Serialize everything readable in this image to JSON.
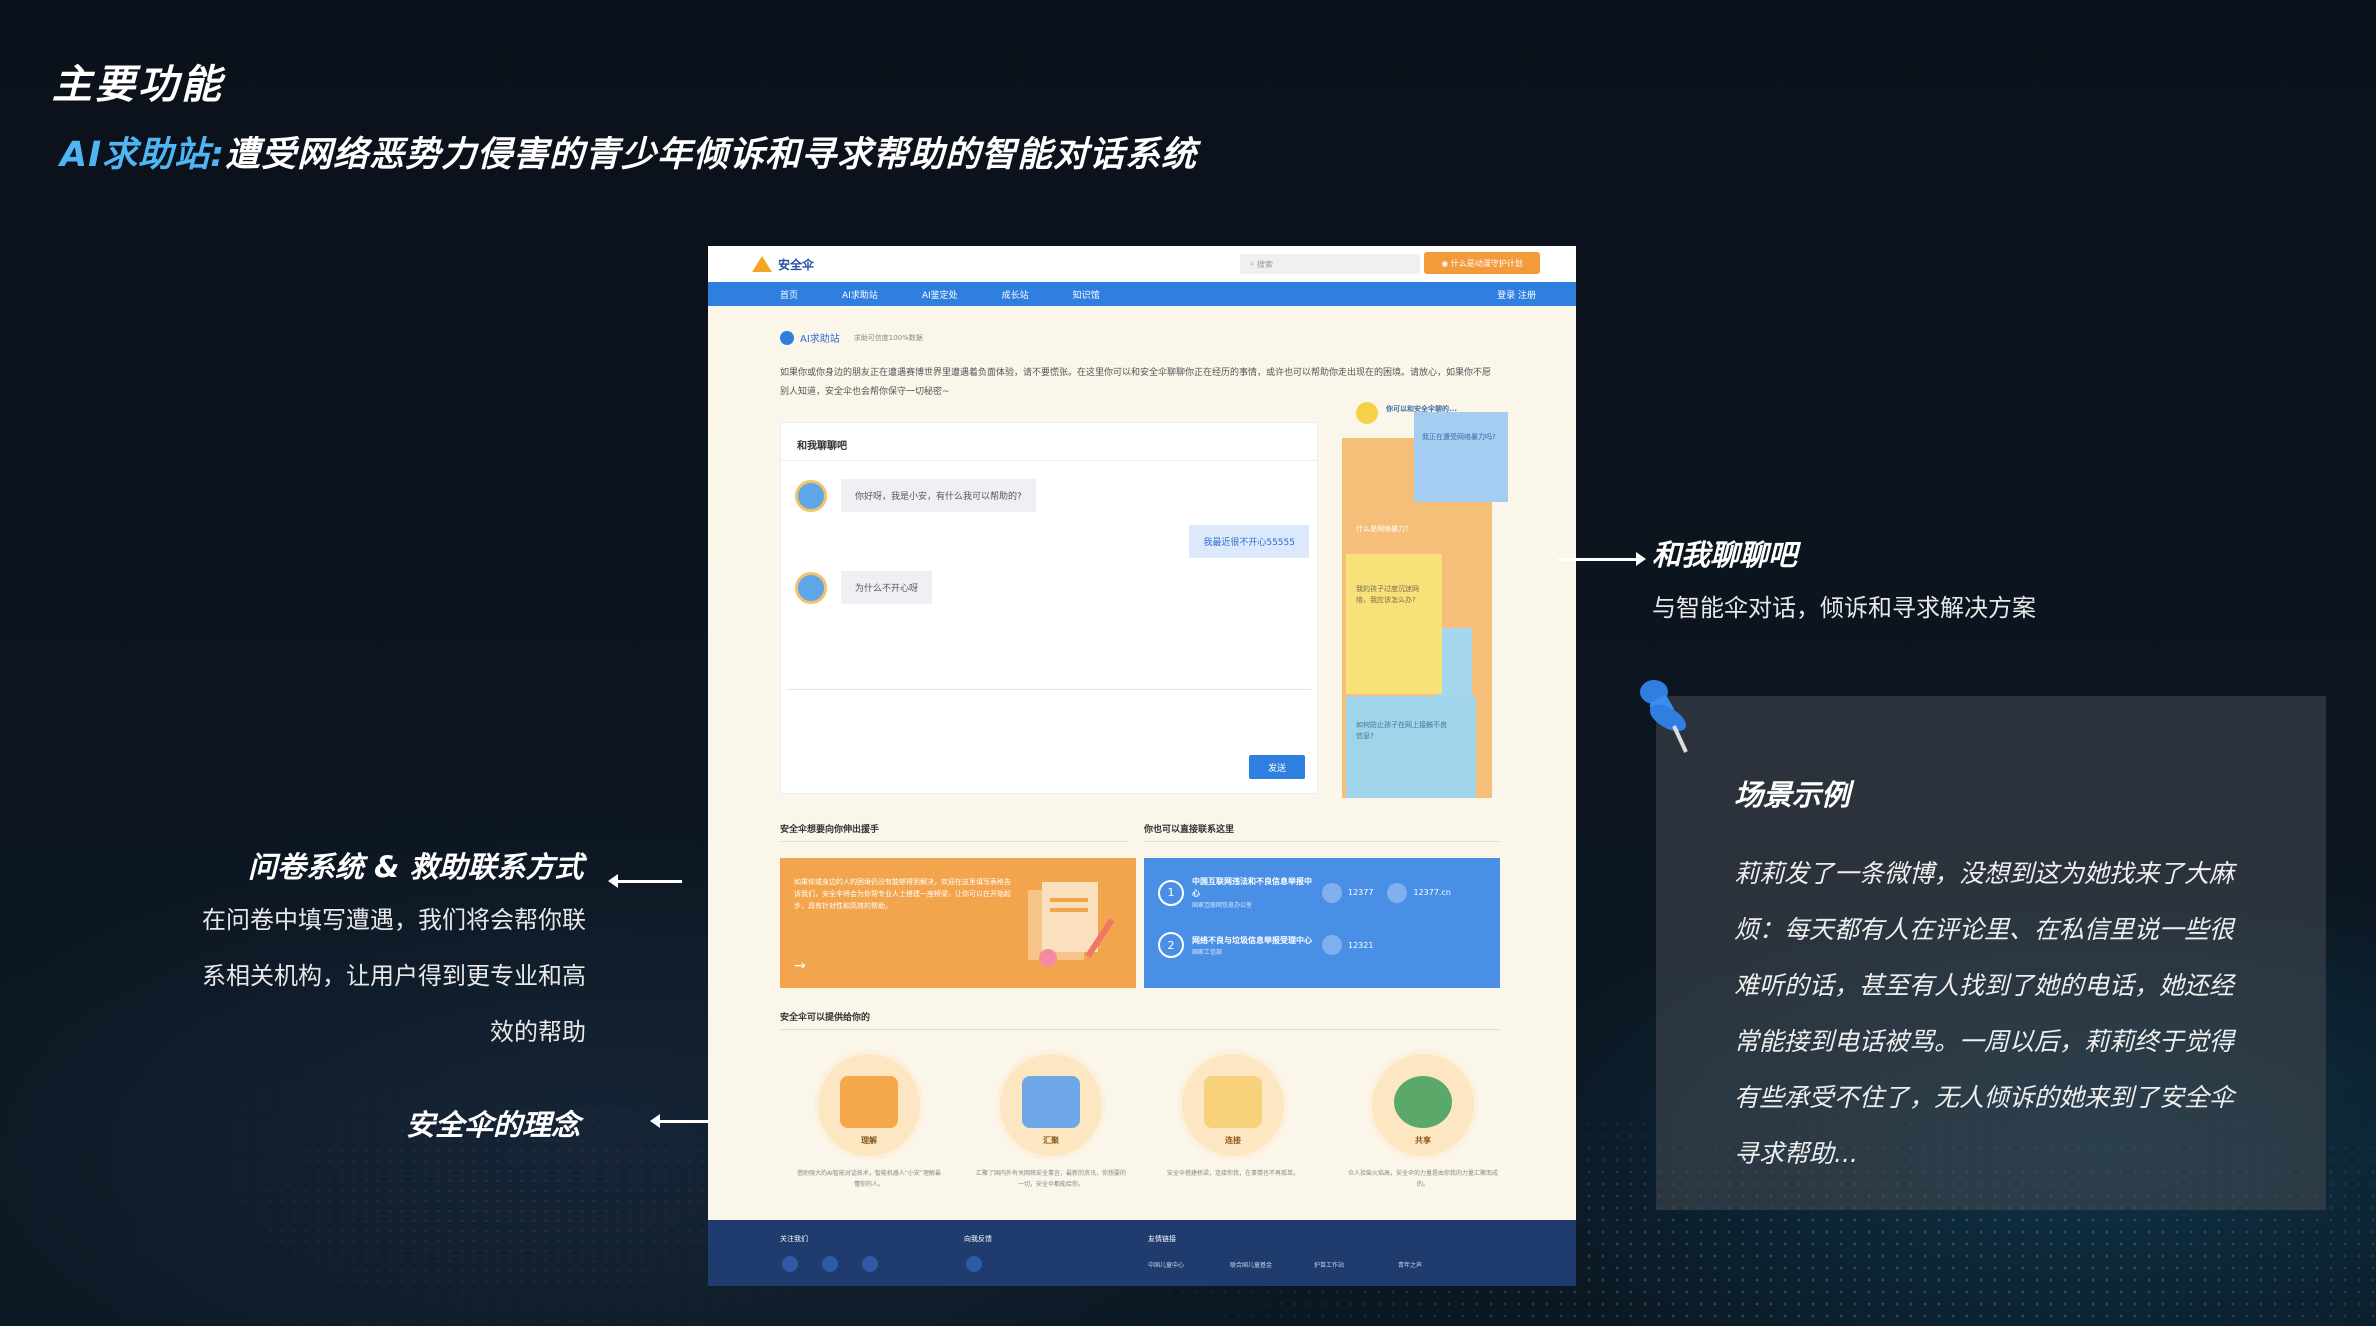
{
  "slide": {
    "title": "主要功能",
    "subtitle_accent": "AI求助站:",
    "subtitle_rest": "遭受网络恶势力侵害的青少年倾诉和寻求帮助的智能对话系统"
  },
  "site": {
    "logo": "安全伞",
    "search_placeholder": "搜索",
    "cta": "什么是动漫守护计划",
    "nav": [
      "首页",
      "AI求助站",
      "AI鉴定处",
      "成长站",
      "知识馆"
    ],
    "nav_active": "AI求助站",
    "auth": "登录   注册",
    "breadcrumb": "AI求助站",
    "breadcrumb_tip": "求助可信度100%数据",
    "intro": "如果你或你身边的朋友正在遭遇赛博世界里遭遇着负面体验，请不要慌张。在这里你可以和安全伞聊聊你正在经历的事情，或许也可以帮助你走出现在的困境。请放心，如果你不愿别人知道，安全伞也会帮你保守一切秘密~",
    "chat": {
      "title": "和我聊聊吧",
      "messages": [
        {
          "from": "bot",
          "text": "你好呀，我是小安，有什么我可以帮助的?"
        },
        {
          "from": "me",
          "text": "我最近很不开心55555"
        },
        {
          "from": "bot",
          "text": "为什么不开心呀"
        }
      ],
      "send": "发送"
    },
    "side_cards": {
      "heading": "你可以和安全伞聊的...",
      "q1": "我正在遭受网络暴力吗?",
      "q2": "什么是网络暴力?",
      "q3": "我的孩子过度沉迷网络，我应该怎么办?",
      "q4": "如何防止孩子在网上接触不良信息?"
    },
    "help_section": {
      "title": "安全伞想要向你伸出援手",
      "text": "如果你或身边的人的困境仍没有能够得到解决，欢迎在这里填写表格告诉我们，安全伞将会为你帮专业人士搭建一座桥梁，让你可以在开始起步，具有针对性和高效的帮助。"
    },
    "contact_section": {
      "title": "你也可以直接联系这里",
      "items": [
        {
          "num": "1",
          "name": "中国互联网违法和不良信息举报中心",
          "org": "国家互联网信息办公室",
          "phone": "12377",
          "web": "12377.cn"
        },
        {
          "num": "2",
          "name": "网络不良与垃圾信息举报受理中心",
          "org": "国家工信部",
          "phone": "12321",
          "web": ""
        }
      ]
    },
    "features_title": "安全伞可以提供给你的",
    "features": [
      {
        "label": "理解",
        "desc": "借助强大的AI智能对话技术，智能机器人“小安”理解最懂你的人。"
      },
      {
        "label": "汇聚",
        "desc": "汇聚了国内外有关网络安全事宜，最新的资讯，你想要的一切，安全伞都能给你。"
      },
      {
        "label": "连接",
        "desc": "安全伞搭建桥梁，连接你我，在事情也不再孤单。"
      },
      {
        "label": "共享",
        "desc": "众人拾柴火焰高，安全伞的力量是由你我的力量汇聚而成的。"
      }
    ],
    "footer": {
      "follow": "关注我们",
      "feedback": "向我反馈",
      "links_title": "友情链接",
      "links": [
        "中国儿童中心",
        "联合国儿童基金",
        "护苗工作站",
        "青年之声"
      ]
    }
  },
  "annotations": {
    "chat_title": "和我聊聊吧",
    "chat_sub": "与智能伞对话，倾诉和寻求解决方案",
    "survey_title": "问卷系统 & 救助联系方式",
    "survey_sub": [
      "在问卷中填写遭遇，我们将会帮你联",
      "系相关机构，让用户得到更专业和高",
      "效的帮助"
    ],
    "concept_title": "安全伞的理念"
  },
  "scenario": {
    "title": "场景示例",
    "text": "莉莉发了一条微博，没想到这为她找来了大麻烦：每天都有人在评论里、在私信里说一些很难听的话，甚至有人找到了她的电话，她还经常能接到电话被骂。一周以后，莉莉终于觉得有些承受不住了，无人倾诉的她来到了安全伞寻求帮助..."
  },
  "colors": {
    "accent": "#4fb6f4",
    "nav": "#2f7fe0",
    "orange": "#f2a54d"
  }
}
